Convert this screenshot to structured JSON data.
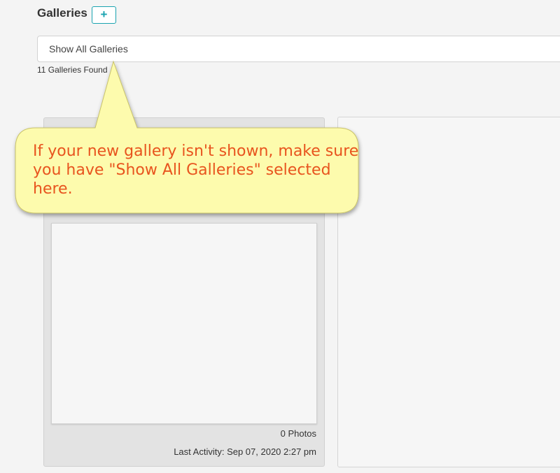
{
  "header": {
    "title": "Galleries",
    "add_label": "+"
  },
  "filter": {
    "selected": "Show All Galleries"
  },
  "summary": {
    "count_text": "11 Galleries Found"
  },
  "card": {
    "photos": "0 Photos",
    "last_activity": "Last Activity: Sep 07, 2020 2:27 pm"
  },
  "callout": {
    "text": "If your new gallery isn't shown, make sure you have \"Show All Galleries\" selected here.",
    "fill_color": "#fdfbad",
    "text_color": "#e8541e"
  },
  "colors": {
    "accent": "#1aa3b0",
    "background": "#f4f4f4"
  }
}
